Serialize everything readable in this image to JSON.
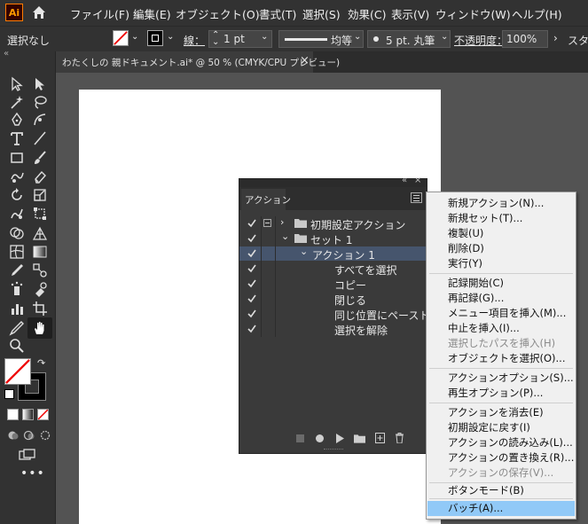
{
  "app": {
    "logo": "Ai"
  },
  "menubar": {
    "items": [
      "ファイル(F)",
      "編集(E)",
      "オブジェクト(O)",
      "書式(T)",
      "選択(S)",
      "効果(C)",
      "表示(V)",
      "ウィンドウ(W)",
      "ヘルプ(H)"
    ]
  },
  "controlbar": {
    "selection": "選択なし",
    "stroke_label": "線：",
    "stroke_weight": "1 pt",
    "stroke_style": "均等",
    "brush": "5 pt. 丸筆",
    "opacity_label": "不透明度：",
    "opacity_value": "100%",
    "style_label": "スタ"
  },
  "document_tab": {
    "title": "わたくしの 親ドキュメント.ai* @ 50 % (CMYK/CPU プレビュー)",
    "close": "×"
  },
  "actions_panel": {
    "tab_label": "アクション",
    "collapse": "«",
    "close": "×",
    "rows": [
      {
        "label": "初期設定アクション"
      },
      {
        "label": "セット 1"
      },
      {
        "label": "アクション 1"
      },
      {
        "label": "すべてを選択"
      },
      {
        "label": "コピー"
      },
      {
        "label": "閉じる"
      },
      {
        "label": "同じ位置にペースト"
      },
      {
        "label": "選択を解除"
      }
    ]
  },
  "context_menu": {
    "items": [
      {
        "label": "新規アクション(N)...",
        "enabled": true
      },
      {
        "label": "新規セット(T)...",
        "enabled": true
      },
      {
        "label": "複製(U)",
        "enabled": true
      },
      {
        "label": "削除(D)",
        "enabled": true
      },
      {
        "label": "実行(Y)",
        "enabled": true
      },
      {
        "label": "記録開始(C)",
        "enabled": true
      },
      {
        "label": "再記録(G)...",
        "enabled": true
      },
      {
        "label": "メニュー項目を挿入(M)...",
        "enabled": true
      },
      {
        "label": "中止を挿入(I)...",
        "enabled": true
      },
      {
        "label": "選択したパスを挿入(H)",
        "enabled": false
      },
      {
        "label": "オブジェクトを選択(O)...",
        "enabled": true
      },
      {
        "label": "アクションオプション(S)...",
        "enabled": true
      },
      {
        "label": "再生オプション(P)...",
        "enabled": true
      },
      {
        "label": "アクションを消去(E)",
        "enabled": true
      },
      {
        "label": "初期設定に戻す(I)",
        "enabled": true
      },
      {
        "label": "アクションの読み込み(L)...",
        "enabled": true
      },
      {
        "label": "アクションの置き換え(R)...",
        "enabled": true
      },
      {
        "label": "アクションの保存(V)...",
        "enabled": false
      },
      {
        "label": "ボタンモード(B)",
        "enabled": true
      },
      {
        "label": "バッチ(A)...",
        "enabled": true,
        "highlighted": true
      }
    ]
  },
  "colors": {
    "ui_dark": "#323232",
    "canvas": "#535353",
    "panel": "#3a3a3a",
    "row_selected": "#46556d",
    "menu_highlight": "#91c9f7",
    "logo_orange": "#ff9a00"
  }
}
